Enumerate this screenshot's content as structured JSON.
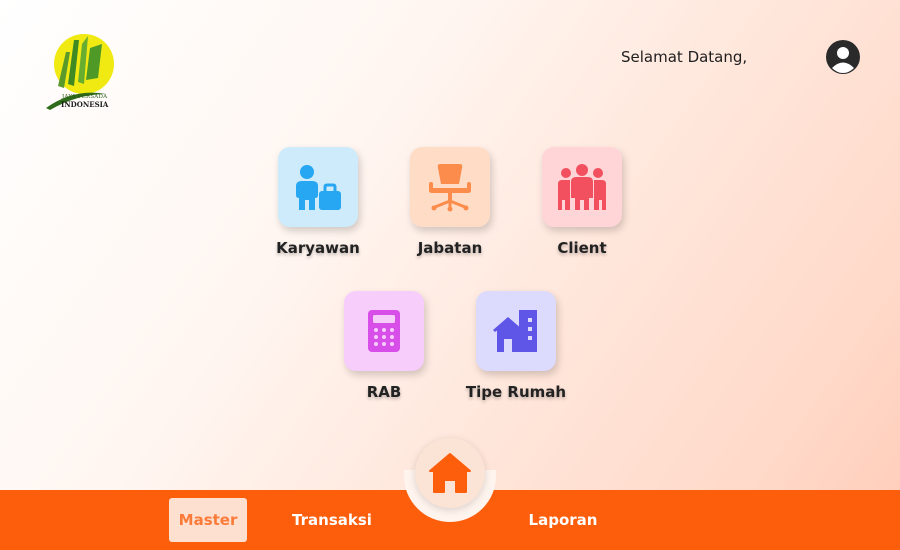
{
  "header": {
    "logo": {
      "line1": "JAYA PERSADA",
      "line2": "INDONESIA"
    },
    "greeting": "Selamat Datang,",
    "user_icon": "user-circle-icon"
  },
  "menu": {
    "items": [
      {
        "label": "Karyawan",
        "icon": "employee-briefcase-icon",
        "tile_color": "#cdebfb",
        "icon_color": "#27a6f2"
      },
      {
        "label": "Jabatan",
        "icon": "office-chair-icon",
        "tile_color": "#ffdcc6",
        "icon_color": "#fc8c4c"
      },
      {
        "label": "Client",
        "icon": "people-group-icon",
        "tile_color": "#ffd5d8",
        "icon_color": "#f3505f"
      },
      {
        "label": "RAB",
        "icon": "calculator-icon",
        "tile_color": "#f6cdfb",
        "icon_color": "#d84ee8"
      },
      {
        "label": "Tipe Rumah",
        "icon": "house-building-icon",
        "tile_color": "#dcdafd",
        "icon_color": "#5f56e8"
      }
    ]
  },
  "bottom_nav": {
    "items": [
      {
        "label": "Master",
        "active": true
      },
      {
        "label": "Transaksi",
        "active": false
      },
      {
        "label": "Laporan",
        "active": false
      }
    ],
    "home_icon": "home-icon",
    "accent": "#fd5e0b"
  }
}
